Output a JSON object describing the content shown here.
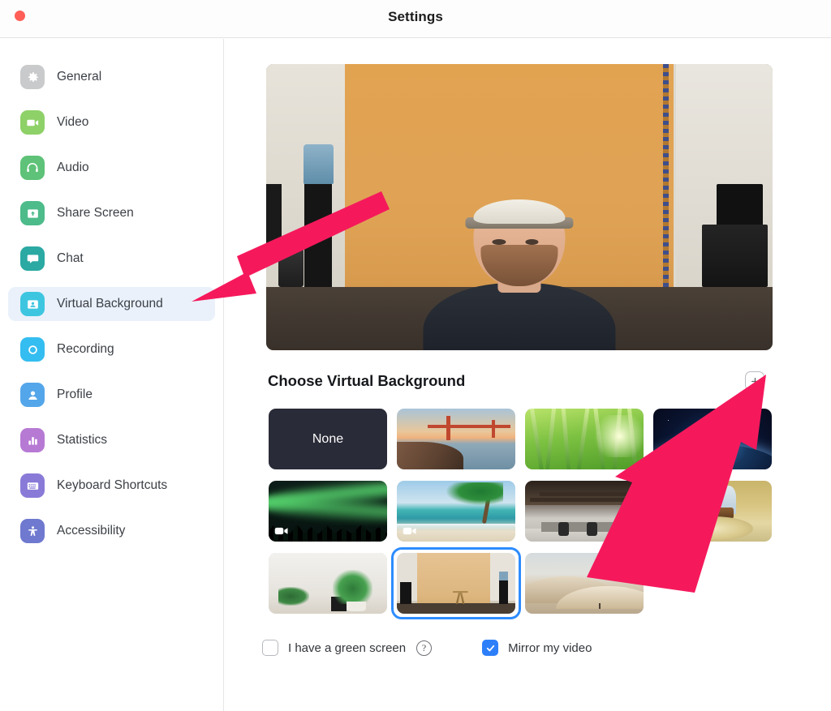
{
  "window": {
    "title": "Settings",
    "close_button": "close"
  },
  "sidebar": {
    "items": [
      {
        "label": "General",
        "icon": "gear-icon",
        "color": "#c9cacb",
        "active": false
      },
      {
        "label": "Video",
        "icon": "video-icon",
        "color": "#8ed168",
        "active": false
      },
      {
        "label": "Audio",
        "icon": "headset-icon",
        "color": "#5ec278",
        "active": false
      },
      {
        "label": "Share Screen",
        "icon": "share-icon",
        "color": "#4dbb8a",
        "active": false
      },
      {
        "label": "Chat",
        "icon": "chat-icon",
        "color": "#2ba9a3",
        "active": false
      },
      {
        "label": "Virtual Background",
        "icon": "person-card-icon",
        "color": "#3ec6e0",
        "active": true
      },
      {
        "label": "Recording",
        "icon": "record-icon",
        "color": "#34bdf0",
        "active": false
      },
      {
        "label": "Profile",
        "icon": "profile-icon",
        "color": "#54a6ea",
        "active": false
      },
      {
        "label": "Statistics",
        "icon": "chart-bar-icon",
        "color": "#b77ad4",
        "active": false
      },
      {
        "label": "Keyboard Shortcuts",
        "icon": "keyboard-icon",
        "color": "#8a7ad8",
        "active": false
      },
      {
        "label": "Accessibility",
        "icon": "accessibility-icon",
        "color": "#6f79cf",
        "active": false
      }
    ]
  },
  "main": {
    "preview_alt": "camera preview of person in front of tan backdrop",
    "section_title": "Choose Virtual Background",
    "add_button_label": "+",
    "thumbnails": [
      {
        "name": "None",
        "kind": "none",
        "selected": false,
        "video": false
      },
      {
        "name": "Golden Gate Bridge",
        "kind": "bridge",
        "selected": false,
        "video": false
      },
      {
        "name": "Grass",
        "kind": "grass",
        "selected": false,
        "video": false
      },
      {
        "name": "Earth from Space",
        "kind": "space",
        "selected": false,
        "video": false
      },
      {
        "name": "Northern Lights",
        "kind": "aurora",
        "selected": false,
        "video": true
      },
      {
        "name": "Beach with Palm",
        "kind": "beach",
        "selected": false,
        "video": true
      },
      {
        "name": "Open Office",
        "kind": "office",
        "selected": false,
        "video": false
      },
      {
        "name": "Oval Office",
        "kind": "oval",
        "selected": false,
        "video": false
      },
      {
        "name": "Plants on Wall",
        "kind": "plant",
        "selected": false,
        "video": false
      },
      {
        "name": "Studio Backdrop",
        "kind": "studio",
        "selected": true,
        "video": false
      },
      {
        "name": "Sand Dunes",
        "kind": "dune",
        "selected": false,
        "video": false
      }
    ],
    "green_screen": {
      "label": "I have a green screen",
      "checked": false,
      "help": "?"
    },
    "mirror_video": {
      "label": "Mirror my video",
      "checked": true
    }
  },
  "annotations": {
    "arrow_color": "#f5195c",
    "arrows": [
      {
        "name": "arrow-to-virtual-background",
        "points_to": "Virtual Background"
      },
      {
        "name": "arrow-to-add-background",
        "points_to": "add background plus button"
      }
    ]
  },
  "colors": {
    "accent_blue": "#2d7ff9",
    "selection_ring": "#2d8cff",
    "sidebar_active_bg": "#eaf1fb",
    "arrow_pink": "#f5195c",
    "close_red": "#ff5f57"
  }
}
